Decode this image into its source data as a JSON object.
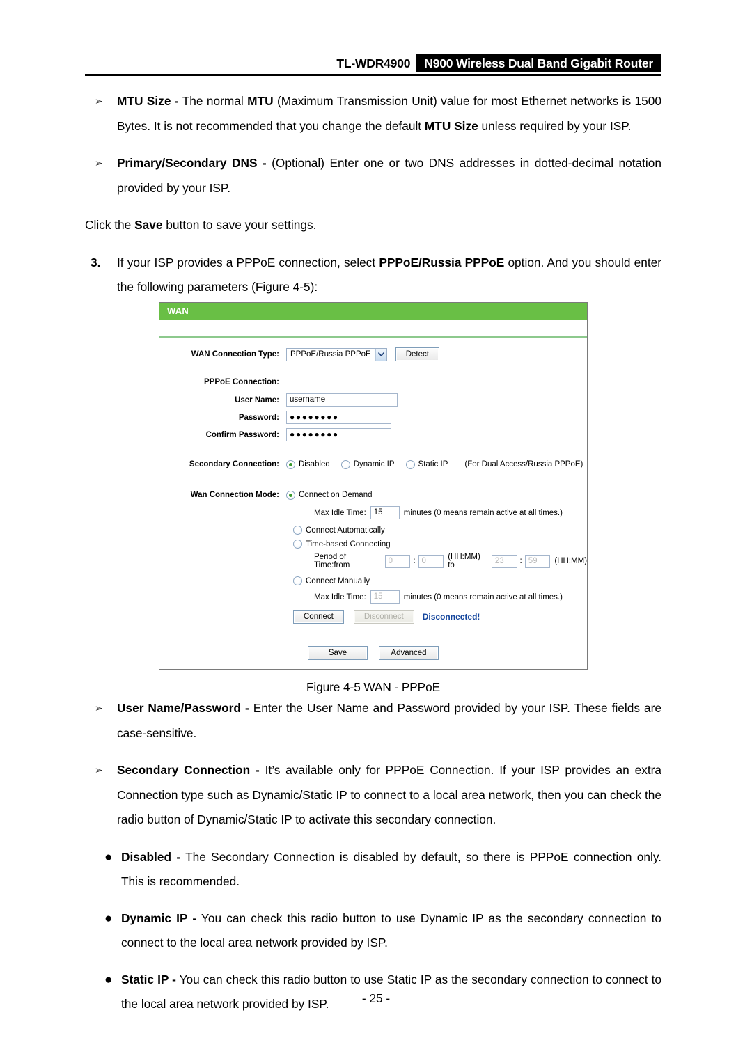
{
  "header": {
    "model": "TL-WDR4900",
    "product": "N900 Wireless Dual Band Gigabit Router"
  },
  "body_text": {
    "mtu_marker": "➢",
    "mtu_term": "MTU Size -",
    "mtu_rest_1": " The normal ",
    "mtu_bold_2": "MTU",
    "mtu_rest_2": " (Maximum Transmission Unit) value for most Ethernet networks is 1500 Bytes. It is not recommended that you change the default ",
    "mtu_bold_3": "MTU Size",
    "mtu_rest_3": " unless required by your ISP.",
    "dns_term": "Primary/Secondary DNS -",
    "dns_rest": " (Optional) Enter one or two DNS addresses in dotted-decimal notation provided by your ISP.",
    "save_line_pre": "Click the ",
    "save_line_bold": "Save",
    "save_line_post": " button to save your settings.",
    "step3_number": "3.",
    "step3_pre": "If your ISP provides a PPPoE connection, select ",
    "step3_bold": "PPPoE/Russia PPPoE",
    "step3_post": " option. And you should enter the following parameters (Figure 4-5):",
    "unp_term": "User Name/Password -",
    "unp_rest": " Enter the User Name and Password provided by your ISP. These fields are case-sensitive.",
    "secconn_term": "Secondary Connection -",
    "secconn_rest": " It’s available only for PPPoE Connection. If your ISP provides an extra Connection type such as Dynamic/Static IP to connect to a local area network, then you can check the radio button of Dynamic/Static IP to activate this secondary connection.",
    "dot_marker": "●",
    "disabled_term": "Disabled -",
    "disabled_rest": " The Secondary Connection is disabled by default, so there is PPPoE connection only. This is recommended.",
    "dynamic_term": "Dynamic IP -",
    "dynamic_rest": " You can check this radio button to use Dynamic IP as the secondary connection to connect to the local area network provided by ISP.",
    "static_term": "Static IP -",
    "static_rest": " You can check this radio button to use Static IP as the secondary connection to connect to the local area network provided by ISP."
  },
  "wan_panel": {
    "title": "WAN",
    "connection_type_label": "WAN Connection Type:",
    "connection_type_value": "PPPoE/Russia PPPoE",
    "detect_button": "Detect",
    "pppoe_connection_label": "PPPoE Connection:",
    "user_name_label": "User Name:",
    "user_name_value": "username",
    "password_label": "Password:",
    "password_value": "●●●●●●●●",
    "confirm_password_label": "Confirm Password:",
    "confirm_password_value": "●●●●●●●●",
    "secondary_connection_label": "Secondary Connection:",
    "secondary_options": [
      {
        "label": "Disabled",
        "selected": true
      },
      {
        "label": "Dynamic IP",
        "selected": false
      },
      {
        "label": "Static IP",
        "selected": false
      }
    ],
    "secondary_note": "(For Dual Access/Russia PPPoE)",
    "wan_connection_mode_label": "Wan Connection Mode:",
    "mode_connect_on_demand": "Connect on Demand",
    "mode_connect_automatically": "Connect Automatically",
    "mode_time_based": "Time-based Connecting",
    "mode_connect_manually": "Connect Manually",
    "max_idle_time_label": "Max Idle Time:",
    "max_idle_time_value_1": "15",
    "max_idle_time_value_2": "15",
    "minutes_note": "minutes (0 means remain active at all times.)",
    "period_label": "Period of Time:from",
    "period_from_hh": "0",
    "period_from_mm": "0",
    "period_to_hh": "23",
    "period_to_mm": "59",
    "hhmm_note_1": "(HH:MM) to",
    "hhmm_note_2": "(HH:MM)",
    "colon": ":",
    "connect_button": "Connect",
    "disconnect_button": "Disconnect",
    "status": "Disconnected!",
    "save_button": "Save",
    "advanced_button": "Advanced"
  },
  "figure_caption": "Figure 4-5 WAN - PPPoE",
  "page_number": "- 25 -",
  "colors": {
    "panel_green": "#69bf45",
    "status_blue": "#12449c",
    "radio_green": "#3a9a2e"
  }
}
